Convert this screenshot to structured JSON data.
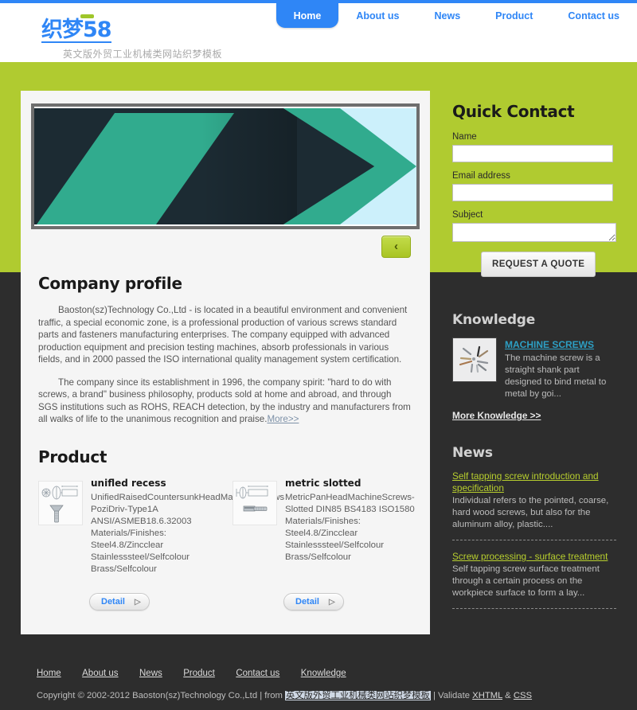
{
  "header": {
    "logo_text": "织梦58",
    "logo_subtitle": "英文版外贸工业机械类网站织梦模板",
    "nav": [
      {
        "label": "Home",
        "active": true
      },
      {
        "label": "About us",
        "active": false
      },
      {
        "label": "News",
        "active": false
      },
      {
        "label": "Product",
        "active": false
      },
      {
        "label": "Contact us",
        "active": false
      }
    ]
  },
  "banner": {
    "prev_label": "‹",
    "colors": {
      "dark": "#1c2b33",
      "teal": "#31ab8e",
      "lightblue": "#ccf0fb",
      "frame": "#6e6e6e"
    }
  },
  "profile": {
    "title": "Company profile",
    "paragraph1": "Baoston(sz)Technology Co.,Ltd - is located in a beautiful environment and convenient traffic, a special economic zone, is a professional production of various screws standard parts and fasteners manufacturing enterprises. The company equipped with advanced production equipment and precision testing machines, absorb professionals in various fields, and in 2000 passed the ISO international quality management system certification.",
    "paragraph2": "The company since its establishment in 1996, the company spirit: \"hard to do with screws, a brand\" business philosophy, products sold at home and abroad, and through SGS institutions such as ROHS, REACH detection, by the industry and manufacturers from all walks of life to the unanimous recognition and praise.",
    "more_label": "More>>"
  },
  "product": {
    "title": "Product",
    "detail_label": "Detail",
    "detail_arrow": "▷",
    "items": [
      {
        "name": "unifled recess",
        "specs": [
          "UnifiedRaisedCountersunkHeadMachineScrews",
          "PoziDriv-Type1A",
          "ANSI/ASMEB18.6.32003",
          "Materials/Finishes:",
          "Steel4.8/Zincclear",
          "Stainlesssteel/Selfcolour",
          "Brass/Selfcolour"
        ]
      },
      {
        "name": "metric slotted",
        "specs": [
          "MetricPanHeadMachineScrews-",
          "Slotted DIN85 BS4183 ISO1580",
          "Materials/Finishes:",
          "Steel4.8/Zincclear",
          "Stainlesssteel/Selfcolour",
          "Brass/Selfcolour"
        ]
      }
    ]
  },
  "quick_contact": {
    "title": "Quick Contact",
    "name_label": "Name",
    "name_value": "",
    "name_placeholder": "",
    "email_label": "Email address",
    "email_value": "",
    "email_placeholder": "",
    "subject_label": "Subject",
    "subject_value": "",
    "subject_placeholder": "",
    "submit_label": "REQUEST A QUOTE"
  },
  "knowledge": {
    "title": "Knowledge",
    "link": "MACHINE SCREWS",
    "excerpt": "The machine screw is a straight shank part designed to bind metal to metal by goi...",
    "more_label": "More Knowledge >>"
  },
  "news": {
    "title": "News",
    "items": [
      {
        "link": "Self tapping screw introduction and specification",
        "excerpt": "Individual refers to the pointed, coarse, hard wood screws, but also for the aluminum alloy, plastic...."
      },
      {
        "link": "Screw processing - surface treatment",
        "excerpt": "Self tapping screw surface treatment through a certain process on the workpiece surface to form a lay..."
      }
    ]
  },
  "footer": {
    "nav": [
      "Home",
      "About us",
      "News",
      "Product",
      "Contact us",
      "Knowledge"
    ],
    "copyright_prefix": "Copyright © 2002-2012 Baoston(sz)Technology Co.,Ltd | from ",
    "template_link": "英文版外贸工业机械类网站织梦模板",
    "validate_prefix": " | Validate ",
    "xhtml_link": "XHTML",
    "amp": " & ",
    "css_link": "CSS"
  },
  "theme": {
    "green": "#b0cb30",
    "blue": "#2f86f6",
    "dark": "#2d2d2d",
    "panel": "#f5f5f5"
  }
}
